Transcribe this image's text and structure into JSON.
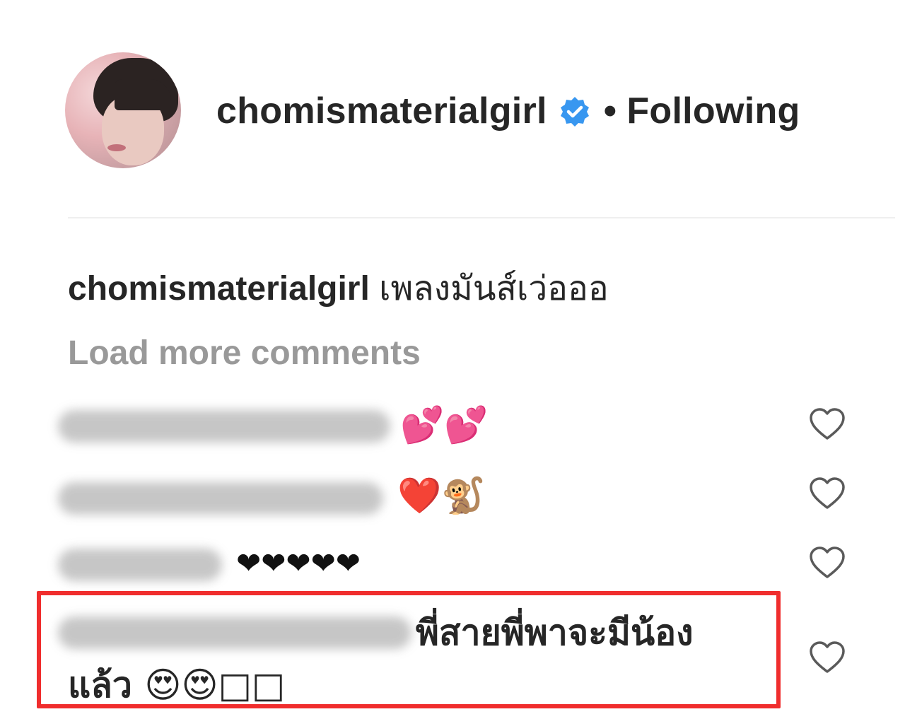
{
  "header": {
    "username": "chomismaterialgirl",
    "separator": "•",
    "follow_status": "Following"
  },
  "caption": {
    "username": "chomismaterialgirl",
    "text": "เพลงมันส์เว่อออ"
  },
  "load_more_label": "Load more comments",
  "comments": [
    {
      "text": "💕💕"
    },
    {
      "text": "❤️🐒"
    },
    {
      "text": "❤❤❤❤❤"
    },
    {
      "text_line1": "พี่สายพี่พาจะมีน้อง",
      "text_line2": "แล้ว 😍😍□□"
    }
  ],
  "icons": {
    "verified": "verified-badge-icon",
    "like": "heart-outline-icon"
  },
  "colors": {
    "verified_blue": "#3897f0",
    "highlight_red": "#f02d2d",
    "muted_text": "#999999"
  }
}
